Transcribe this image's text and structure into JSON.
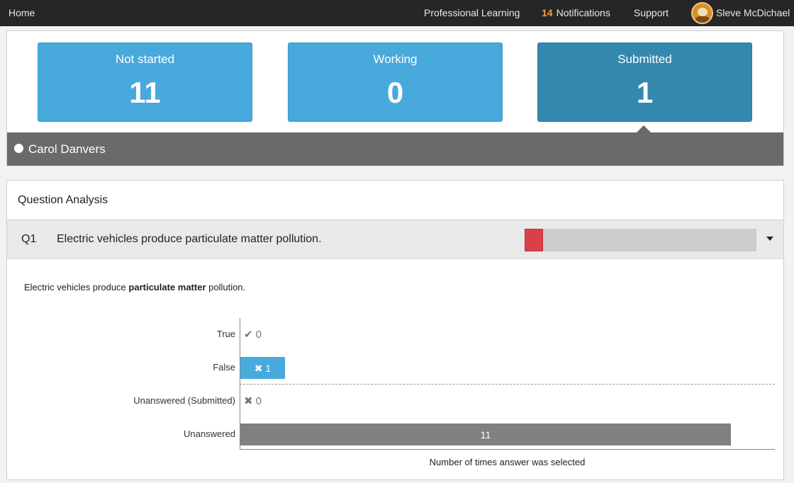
{
  "topbar": {
    "home": "Home",
    "professional_learning": "Professional Learning",
    "notifications_count": "14",
    "notifications_label": "Notifications",
    "support": "Support",
    "user_name": "Sleve McDichael"
  },
  "status": {
    "cards": [
      {
        "label": "Not started",
        "count": "11"
      },
      {
        "label": "Working",
        "count": "0"
      },
      {
        "label": "Submitted",
        "count": "1"
      }
    ],
    "selected_student": "Carol Danvers"
  },
  "question_analysis": {
    "title": "Question Analysis",
    "question": {
      "number": "Q1",
      "text": "Electric vehicles produce particulate matter pollution.",
      "prompt_before": "Electric vehicles produce ",
      "prompt_bold": "particulate matter",
      "prompt_after": " pollution.",
      "correct_fraction": 0.08
    }
  },
  "colors": {
    "card": "#48a9dc",
    "card_selected": "#3488ad",
    "student_bar": "#6a6a6a",
    "incorrect_progress": "#d9404a",
    "false_bar": "#48a9dc",
    "unanswered_bar": "#808080"
  },
  "icons": {
    "correct": "check-icon",
    "incorrect": "cross-icon",
    "toggle": "chevron-down-icon"
  },
  "chart_data": {
    "type": "bar",
    "orientation": "horizontal",
    "categories": [
      "True",
      "False",
      "Unanswered (Submitted)",
      "Unanswered"
    ],
    "values": [
      0,
      1,
      0,
      11
    ],
    "markers": [
      "✔",
      "✖",
      "✖",
      ""
    ],
    "xlabel": "Number of times answer was selected",
    "xlim": [
      0,
      12
    ]
  }
}
